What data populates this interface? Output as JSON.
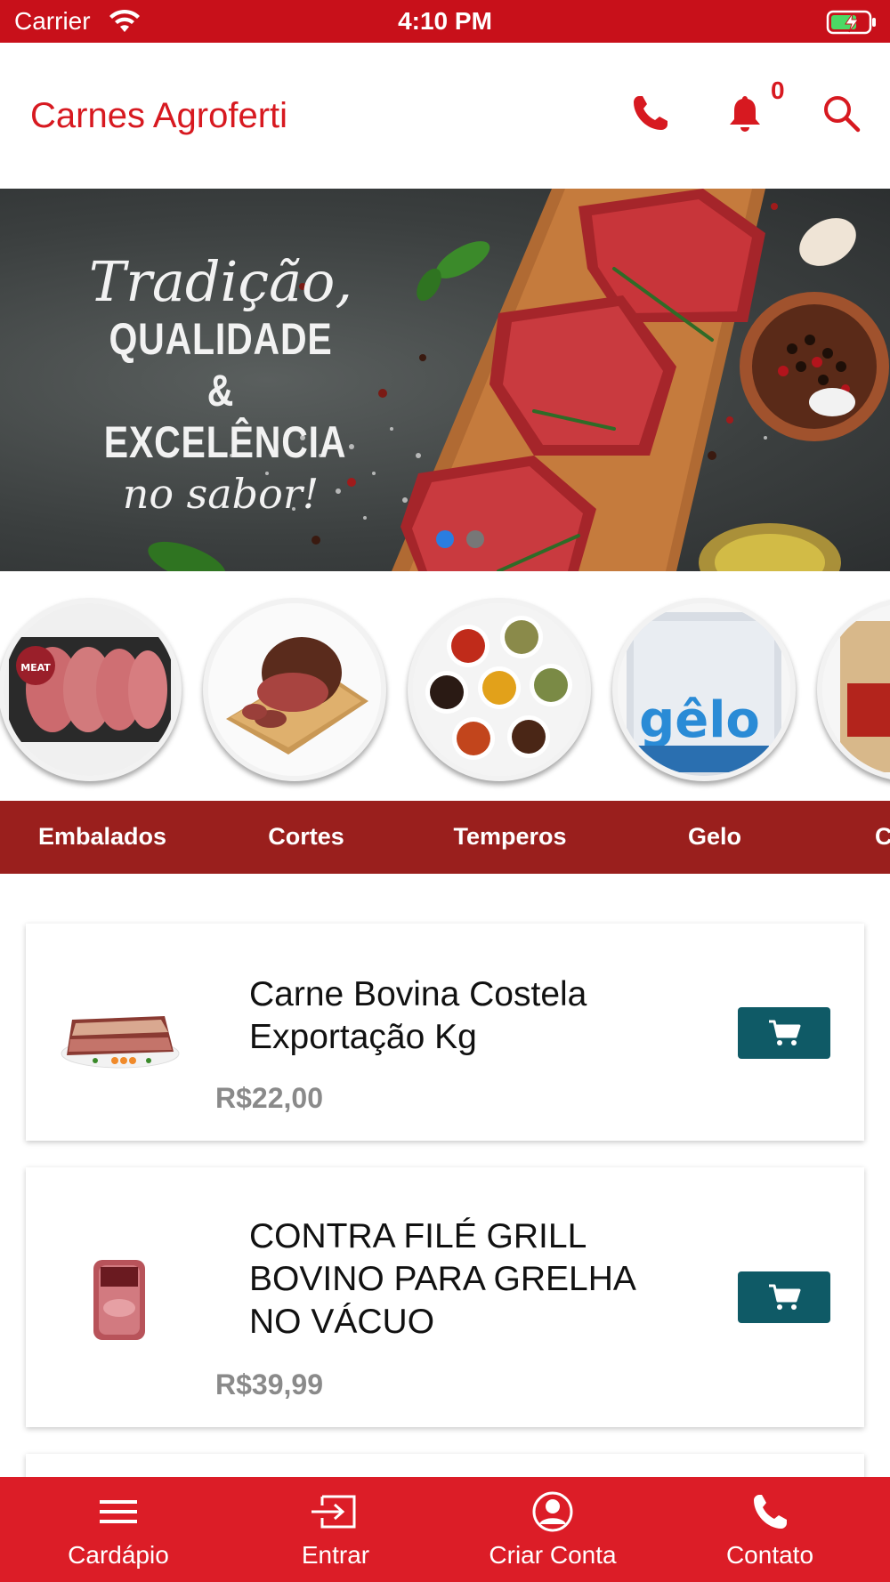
{
  "status_bar": {
    "carrier": "Carrier",
    "time": "4:10 PM"
  },
  "header": {
    "title": "Carnes Agroferti",
    "notification_count": "0",
    "icons": [
      "phone-icon",
      "bell-icon",
      "search-icon"
    ],
    "accent_color": "#d71920"
  },
  "banner": {
    "line1": "Tradição,",
    "line2": "QUALIDADE",
    "line3": "& EXCELÊNCIA",
    "line4": "no sabor!",
    "active_slide_index": 0
  },
  "categories": {
    "tabs": [
      "Embalados",
      "Cortes",
      "Temperos",
      "Gelo",
      "C"
    ],
    "tab_bar_color": "#9a1f1d"
  },
  "products": [
    {
      "name_line1": "Carne Bovina Costela",
      "name_line2": "Exportação Kg",
      "price": "R$22,00"
    },
    {
      "name_line1": "CONTRA FILÉ GRILL",
      "name_line2": "BOVINO PARA GRELHA",
      "name_line3": "NO VÁCUO",
      "price": "R$39,99"
    }
  ],
  "cart_button_color": "#0f5a66",
  "bottom_nav": {
    "items": [
      {
        "label": "Cardápio",
        "icon": "menu-icon"
      },
      {
        "label": "Entrar",
        "icon": "login-icon"
      },
      {
        "label": "Criar Conta",
        "icon": "user-icon"
      },
      {
        "label": "Contato",
        "icon": "phone-icon"
      }
    ],
    "color": "#dc1d27"
  }
}
